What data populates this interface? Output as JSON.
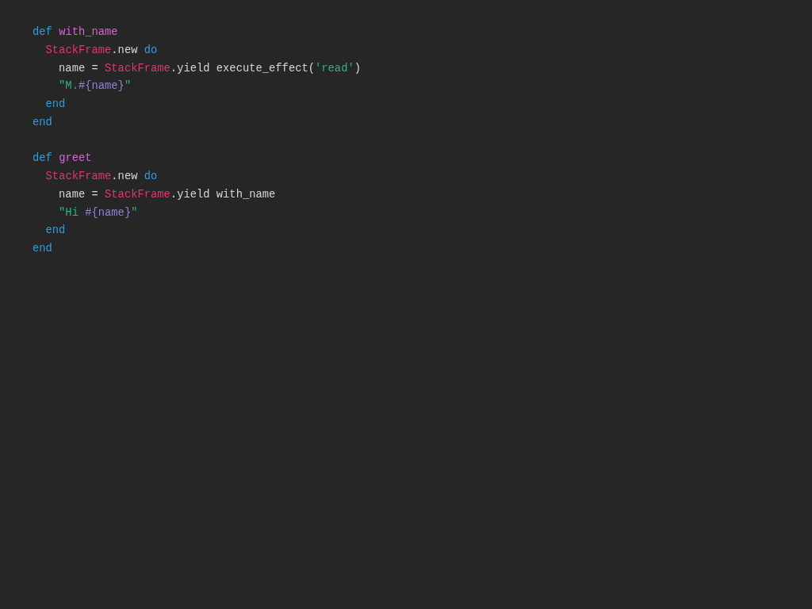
{
  "code_blocks": [
    {
      "lines": [
        {
          "tokens": [
            {
              "text": "def ",
              "kind": "keyword"
            },
            {
              "text": "with_name",
              "kind": "method"
            }
          ],
          "children": [
            {
              "tokens": [
                {
                  "text": "StackFrame",
                  "kind": "constant"
                },
                {
                  "text": ".new ",
                  "kind": "plain"
                },
                {
                  "text": "do",
                  "kind": "keyword"
                }
              ],
              "children": [
                {
                  "tokens": [
                    {
                      "text": "name = ",
                      "kind": "plain"
                    },
                    {
                      "text": "StackFrame",
                      "kind": "constant"
                    },
                    {
                      "text": ".yield execute_effect(",
                      "kind": "plain"
                    },
                    {
                      "text": "'read'",
                      "kind": "string"
                    },
                    {
                      "text": ")",
                      "kind": "plain"
                    }
                  ]
                },
                {
                  "tokens": [
                    {
                      "text": "\"M.",
                      "kind": "string"
                    },
                    {
                      "text": "#{name}",
                      "kind": "interpolation"
                    },
                    {
                      "text": "\"",
                      "kind": "string"
                    }
                  ]
                }
              ]
            },
            {
              "tokens": [
                {
                  "text": "end",
                  "kind": "keyword"
                }
              ]
            }
          ]
        },
        {
          "tokens": [
            {
              "text": "end",
              "kind": "keyword"
            }
          ]
        }
      ]
    },
    {
      "lines": [
        {
          "tokens": [
            {
              "text": "def ",
              "kind": "keyword"
            },
            {
              "text": "greet",
              "kind": "method"
            }
          ],
          "children": [
            {
              "tokens": [
                {
                  "text": "StackFrame",
                  "kind": "constant"
                },
                {
                  "text": ".new ",
                  "kind": "plain"
                },
                {
                  "text": "do",
                  "kind": "keyword"
                }
              ],
              "children": [
                {
                  "tokens": [
                    {
                      "text": "name = ",
                      "kind": "plain"
                    },
                    {
                      "text": "StackFrame",
                      "kind": "constant"
                    },
                    {
                      "text": ".yield with_name",
                      "kind": "plain"
                    }
                  ]
                },
                {
                  "tokens": [
                    {
                      "text": "\"Hi ",
                      "kind": "string"
                    },
                    {
                      "text": "#{name}",
                      "kind": "interpolation"
                    },
                    {
                      "text": "\"",
                      "kind": "string"
                    }
                  ]
                }
              ]
            },
            {
              "tokens": [
                {
                  "text": "end",
                  "kind": "keyword"
                }
              ]
            }
          ]
        },
        {
          "tokens": [
            {
              "text": "end",
              "kind": "keyword"
            }
          ]
        }
      ]
    }
  ]
}
